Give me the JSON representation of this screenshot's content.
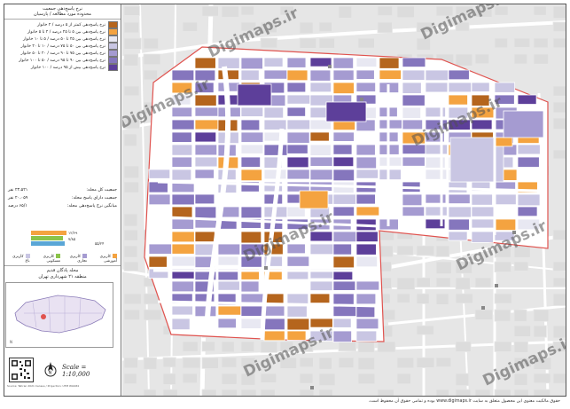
{
  "legend": {
    "title_line1": "نرخ پاسخ‌دهی جمعیت",
    "title_line2": "محدوده مورد مطالعه / پارسیان",
    "items": [
      {
        "label": "نرخ پاسخ‌دهی کمتر از ۵ درصد / ۲ خانوار",
        "color": "#b5651d"
      },
      {
        "label": "نرخ پاسخ‌دهی بین ۵ تا ۲۵ درصد / ۲ تا ۵ خانوار",
        "color": "#f4a340"
      },
      {
        "label": "نرخ پاسخ‌دهی بین ۲۵ تا ۵۰ درصد / ۵ تا ۱۰ خانوار",
        "color": "#e8e8f2"
      },
      {
        "label": "نرخ پاسخ‌دهی بین ۵۰ تا ۷۵ درصد / ۱۰ تا ۲۰ خانوار",
        "color": "#c9c6e3"
      },
      {
        "label": "نرخ پاسخ‌دهی بین ۷۵ تا ۹۰ درصد / ۲۰ تا ۵۰ خانوار",
        "color": "#a59bd1"
      },
      {
        "label": "نرخ پاسخ‌دهی بین ۹۰ تا ۹۵ درصد / ۵۰ تا ۱۰۰ خانوار",
        "color": "#8576bd"
      },
      {
        "label": "نرخ پاسخ‌دهی بیش از ۹۵ درصد / ۱۰۰ خانوار",
        "color": "#5d3f9a"
      }
    ],
    "stats": [
      {
        "label": "جمعیت کل محله:",
        "value": "۲۳،۵۲۱ نفر"
      },
      {
        "label": "جمعیت دارای پاسخ محله:",
        "value": "۲۰،۰۵۹ نفر"
      },
      {
        "label": "میانگین نرخ پاسخ‌دهی محله:",
        "value": "۶۵/۱ درصد"
      }
    ],
    "bar_labels": {
      "top": "۱۲/۶۹",
      "mid": "۷/۸۵",
      "right": "۵۵/۲۴"
    },
    "landuse": [
      {
        "label": "کاربری آموزشی",
        "color": "#f4a340"
      },
      {
        "label": "کاربری تجاری",
        "color": "#a59bd1"
      },
      {
        "label": "کاربری مسکونی",
        "color": "#8bc34a"
      },
      {
        "label": "کاربری باغ",
        "color": "#c9c6e3"
      }
    ],
    "district_line1": "محله پادگان قدیم",
    "district_line2": "منطقه ۲۱ شهرداری تهران",
    "scale_text": "Scale = 1:10,000",
    "credit": "Source: Tehran 2021 Census / Projection: UTM WGS84"
  },
  "watermark": "Digimaps.ir",
  "footer_text": "حقوق مالکیت معنوی این محصول متعلق به سایت www.digimaps.ir بوده و تمامی حقوق آن محفوظ است.",
  "colors": {
    "boundary": "#e0534f",
    "basemap": "#e6e6e6",
    "road": "#ffffff",
    "park": "#d4d4d4"
  }
}
